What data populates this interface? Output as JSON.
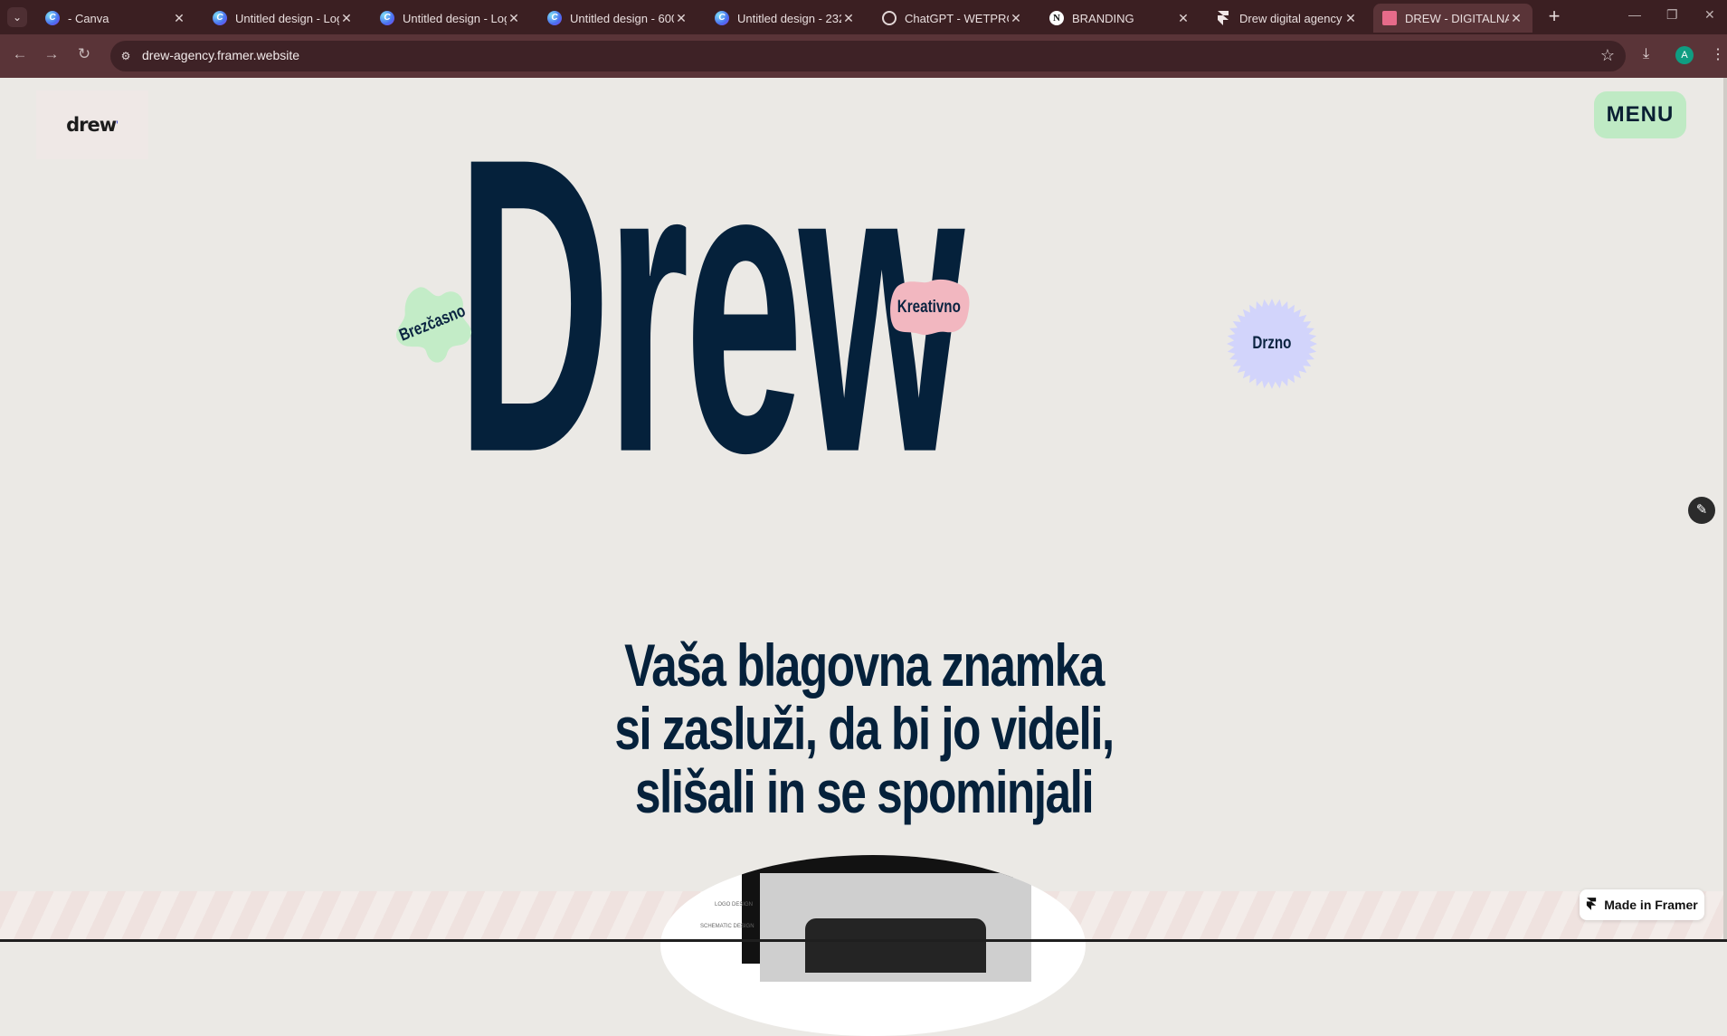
{
  "browser": {
    "tabs": [
      {
        "title": "- Canva",
        "icon": "canva-icon"
      },
      {
        "title": "Untitled design - Log",
        "icon": "canva-icon"
      },
      {
        "title": "Untitled design - Log",
        "icon": "canva-icon"
      },
      {
        "title": "Untitled design - 600",
        "icon": "canva-icon"
      },
      {
        "title": "Untitled design - 232",
        "icon": "canva-icon"
      },
      {
        "title": "ChatGPT - WETPROJE",
        "icon": "chatgpt-icon"
      },
      {
        "title": "BRANDING",
        "icon": "notion-icon"
      },
      {
        "title": "Drew digital agency -",
        "icon": "framer-icon"
      },
      {
        "title": "DREW - DIGITALNA A",
        "icon": "drew-icon",
        "active": true
      }
    ],
    "url": "drew-agency.framer.website",
    "profile_initial": "A",
    "colors": {
      "frame": "#3b1f22",
      "toolbar": "#5a3438"
    }
  },
  "site": {
    "logo": "drew",
    "menu_label": "MENU",
    "hero_word": "Drew",
    "stickers": {
      "green": "Brezčasno",
      "pink": "Kreativno",
      "lavender": "Drzno"
    },
    "tagline": [
      "Vaša blagovna znamka",
      "si zasluži, da bi jo videli,",
      "slišali in se spominjali"
    ],
    "promo_labels": [
      "LOGO DESIGN",
      "SCHEMATIC DESIGN"
    ],
    "badge": "Made in Framer",
    "colors": {
      "ink": "#05213b",
      "background": "#ebe9e5",
      "menu": "#bfeac4",
      "green_sticker": "#c3ecc7",
      "pink_sticker": "#f2b7c0",
      "lavender_sticker": "#d2d4fb"
    }
  }
}
